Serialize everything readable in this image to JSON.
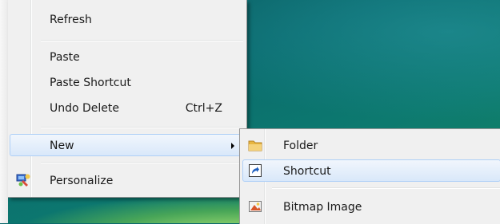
{
  "context_menu": {
    "items": [
      {
        "label": "Refresh"
      },
      {
        "label": "Paste"
      },
      {
        "label": "Paste Shortcut"
      },
      {
        "label": "Undo Delete",
        "shortcut": "Ctrl+Z"
      },
      {
        "label": "New",
        "has_submenu": true,
        "highlighted": true
      },
      {
        "label": "Personalize",
        "icon": "personalize-icon"
      }
    ]
  },
  "new_submenu": {
    "items": [
      {
        "label": "Folder",
        "icon": "folder-icon"
      },
      {
        "label": "Shortcut",
        "icon": "shortcut-icon",
        "highlighted": true
      },
      {
        "label": "Bitmap Image",
        "icon": "bitmap-image-icon"
      }
    ]
  },
  "colors": {
    "menu_background": "#f0f0f0",
    "highlight_border": "#aecff7",
    "desktop": "#0b6a6c"
  }
}
